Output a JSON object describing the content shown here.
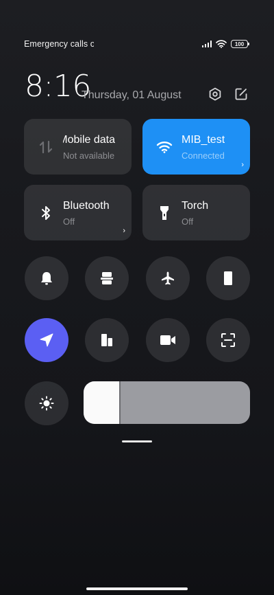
{
  "status": {
    "carrier_text": "Emergency calls only",
    "battery": "100"
  },
  "header": {
    "time": "8:16",
    "date": "Thursday, 01 August",
    "settings_icon": "hexagon-settings-icon",
    "edit_icon": "edit-icon"
  },
  "tiles": [
    {
      "label": "Mobile data",
      "status": "Not available",
      "icon": "mobile-data-icon",
      "active": false
    },
    {
      "label": "MIB_test",
      "status": "Connected",
      "icon": "wifi-icon",
      "active": true
    },
    {
      "label": "Bluetooth",
      "status": "Off",
      "icon": "bluetooth-icon",
      "active": false
    },
    {
      "label": "Torch",
      "status": "Off",
      "icon": "torch-icon",
      "active": false
    }
  ],
  "toggles": [
    {
      "icon": "bell-icon",
      "active": false
    },
    {
      "icon": "screenshot-icon",
      "active": false
    },
    {
      "icon": "airplane-icon",
      "active": false
    },
    {
      "icon": "phone-rotate-icon",
      "active": false
    },
    {
      "icon": "location-icon",
      "active": true
    },
    {
      "icon": "reading-mode-icon",
      "active": false
    },
    {
      "icon": "screen-recorder-icon",
      "active": false
    },
    {
      "icon": "scanner-icon",
      "active": false
    }
  ],
  "brightness": {
    "icon": "brightness-icon",
    "level": 0.22
  },
  "colors": {
    "wifi_active": "#1e90f5",
    "location_active": "#5b5ff3"
  }
}
